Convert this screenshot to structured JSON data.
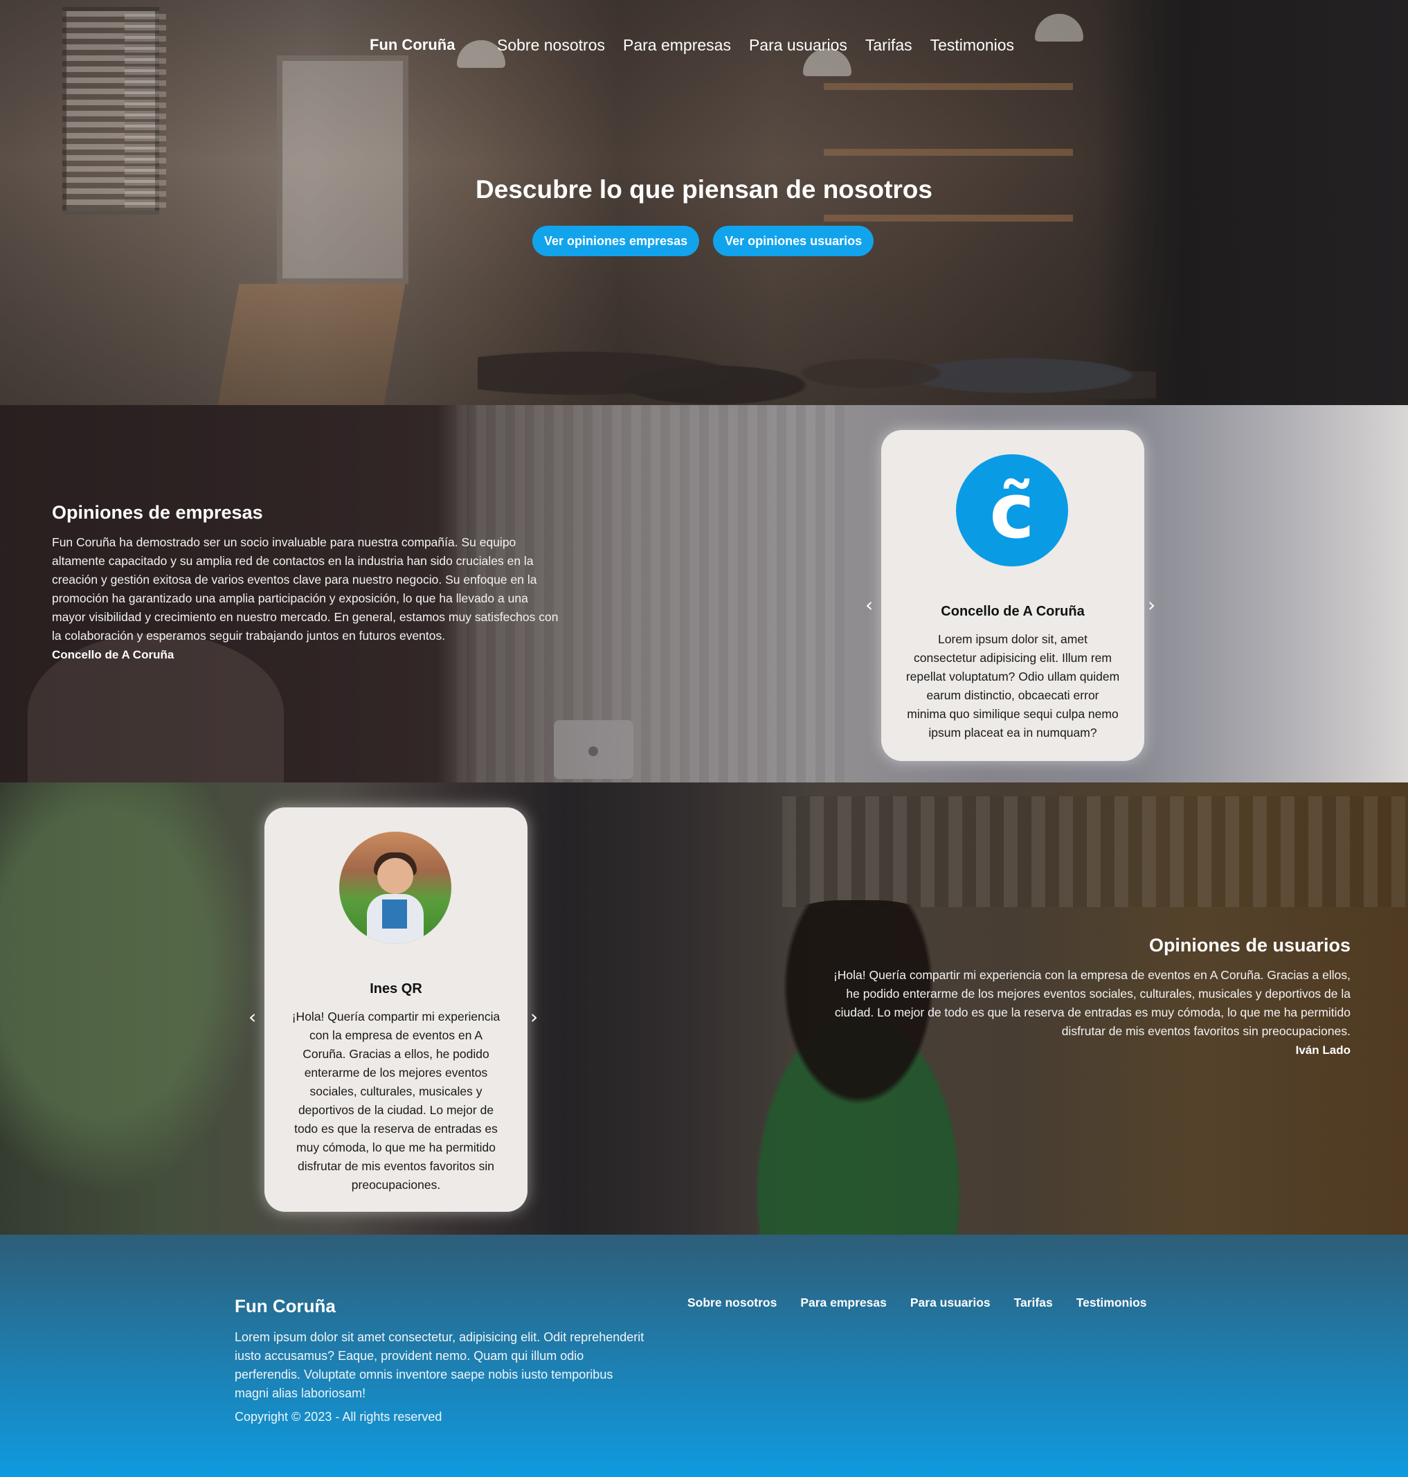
{
  "nav": {
    "brand": "Fun Coruña",
    "links": [
      "Sobre nosotros",
      "Para empresas",
      "Para usuarios",
      "Tarifas",
      "Testimonios"
    ]
  },
  "hero": {
    "title": "Descubre lo que piensan de nosotros",
    "button_companies": "Ver opiniones empresas",
    "button_users": "Ver opiniones usuarios"
  },
  "companies": {
    "title": "Opiniones de empresas",
    "text": "Fun Coruña ha demostrado ser un socio invaluable para nuestra compañía. Su equipo altamente capacitado y su amplia red de contactos en la industria han sido cruciales en la creación y gestión exitosa de varios eventos clave para nuestro negocio. Su enfoque en la promoción ha garantizado una amplia participación y exposición, lo que ha llevado a una mayor visibilidad y crecimiento en nuestro mercado. En general, estamos muy satisfechos con la colaboración y esperamos seguir trabajando juntos en futuros eventos.",
    "author": "Concello de A Coruña",
    "card": {
      "logo_glyph": "c̃",
      "name": "Concello de A Coruña",
      "text": "Lorem ipsum dolor sit, amet consectetur adipisicing elit. Illum rem repellat voluptatum? Odio ullam quidem earum distinctio, obcaecati error minima quo similique sequi culpa nemo ipsum placeat ea in numquam?",
      "prev": "‹",
      "next": "›"
    }
  },
  "users": {
    "title": "Opiniones de usuarios",
    "text": "¡Hola! Quería compartir mi experiencia con la empresa de eventos en A Coruña. Gracias a ellos, he podido enterarme de los mejores eventos sociales, culturales, musicales y deportivos de la ciudad. Lo mejor de todo es que la reserva de entradas es muy cómoda, lo que me ha permitido disfrutar de mis eventos favoritos sin preocupaciones.",
    "author": "Iván Lado",
    "card": {
      "name": "Ines QR",
      "text": "¡Hola! Quería compartir mi experiencia con la empresa de eventos en A Coruña. Gracias a ellos, he podido enterarme de los mejores eventos sociales, culturales, musicales y deportivos de la ciudad. Lo mejor de todo es que la reserva de entradas es muy cómoda, lo que me ha permitido disfrutar de mis eventos favoritos sin preocupaciones.",
      "prev": "‹",
      "next": "›"
    }
  },
  "footer": {
    "brand": "Fun Coruña",
    "description": "Lorem ipsum dolor sit amet consectetur, adipisicing elit. Odit reprehenderit iusto accusamus? Eaque, provident nemo. Quam qui illum odio perferendis. Voluptate omnis inventore saepe nobis iusto temporibus magni alias laboriosam!",
    "copyright": "Copyright © 2023 - All rights reserved",
    "links": [
      "Sobre nosotros",
      "Para empresas",
      "Para usuarios",
      "Tarifas",
      "Testimonios"
    ]
  },
  "colors": {
    "accent": "#11a4ec",
    "card_bg": "#edeae7",
    "footer_top": "#2e5e78",
    "footer_bottom": "#0e9be0"
  }
}
